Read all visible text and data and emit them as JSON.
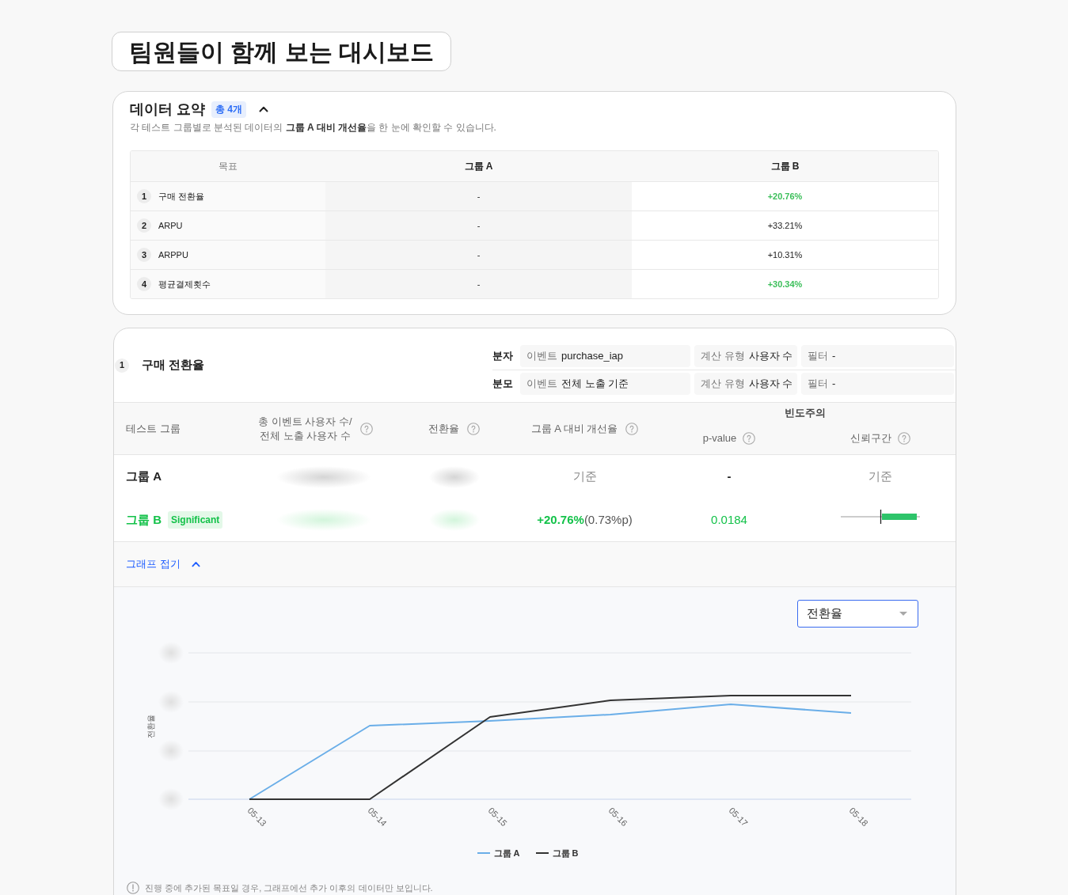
{
  "page_title": "팀원들이 함께 보는 대시보드",
  "summary": {
    "title": "데이터 요약",
    "count_badge": "총 4개",
    "expanded": true,
    "description": "각 테스트 그룹별로 분석된 데이터의 **그룹 A 대비 개선율**을 한 눈에 확인할 수 있습니다.",
    "columns": [
      "목표",
      "그룹 A",
      "그룹 B"
    ],
    "rows": [
      {
        "index": "1",
        "goal": "구매 전환율",
        "group_a": "-",
        "group_b": "+20.76%",
        "significant": true
      },
      {
        "index": "2",
        "goal": "ARPU",
        "group_a": "-",
        "group_b": "+33.21%",
        "significant": false
      },
      {
        "index": "3",
        "goal": "ARPPU",
        "group_a": "-",
        "group_b": "+10.31%",
        "significant": false
      },
      {
        "index": "4",
        "goal": "평균결제횟수",
        "group_a": "-",
        "group_b": "+30.34%",
        "significant": true
      }
    ]
  },
  "metric": {
    "index": "1",
    "title": "구매 전환율",
    "definition": [
      {
        "label": "분자",
        "fields": [
          {
            "label": "이벤트",
            "value": "purchase_iap"
          },
          {
            "label": "계산 유형",
            "value": "사용자 수"
          },
          {
            "label": "필터",
            "value": "-"
          }
        ]
      },
      {
        "label": "분모",
        "fields": [
          {
            "label": "이벤트",
            "value": "전체 노출 기준"
          },
          {
            "label": "계산 유형",
            "value": "사용자 수"
          },
          {
            "label": "필터",
            "value": "-"
          }
        ]
      }
    ],
    "columns": [
      {
        "lines": [
          "테스트 그룹"
        ],
        "help": false
      },
      {
        "lines": [
          "총 이벤트 사용자 수/",
          "전체 노출 사용자 수"
        ],
        "help": true
      },
      {
        "lines": [
          "전환율"
        ],
        "help": true
      },
      {
        "lines": [
          "그룹 A 대비 개선율"
        ],
        "help": true
      }
    ],
    "column_group": {
      "title": "빈도주의",
      "columns": [
        {
          "lines": [
            "p-value"
          ],
          "help": true
        },
        {
          "lines": [
            "신뢰구간"
          ],
          "help": true
        }
      ]
    },
    "rows": [
      {
        "name": "그룹 A",
        "significant": false,
        "improvement": {
          "value": "기준"
        },
        "p_value": "-",
        "interval": {
          "kind": "text",
          "text": "기준"
        }
      },
      {
        "name": "그룹 B",
        "significant": true,
        "badge": "Significant",
        "improvement": {
          "value": "+20.76%",
          "detail": "(0.73%p)"
        },
        "p_value": "0.0184",
        "interval": {
          "kind": "plot"
        }
      }
    ]
  },
  "graph_toggle": {
    "label": "그래프 접기",
    "expanded": true
  },
  "chart": {
    "metric_select": "전환율",
    "ylabel": "전환율",
    "x_labels": [
      "05-13",
      "05-14",
      "05-15",
      "05-16",
      "05-17",
      "05-18"
    ],
    "legend": [
      {
        "name": "그룹 A",
        "color": "#6aaee8"
      },
      {
        "name": "그룹 B",
        "color": "#333333"
      }
    ]
  },
  "note": "진행 중에 추가된 목표일 경우, 그래프에선 추가 이후의 데이터만 보입니다."
}
